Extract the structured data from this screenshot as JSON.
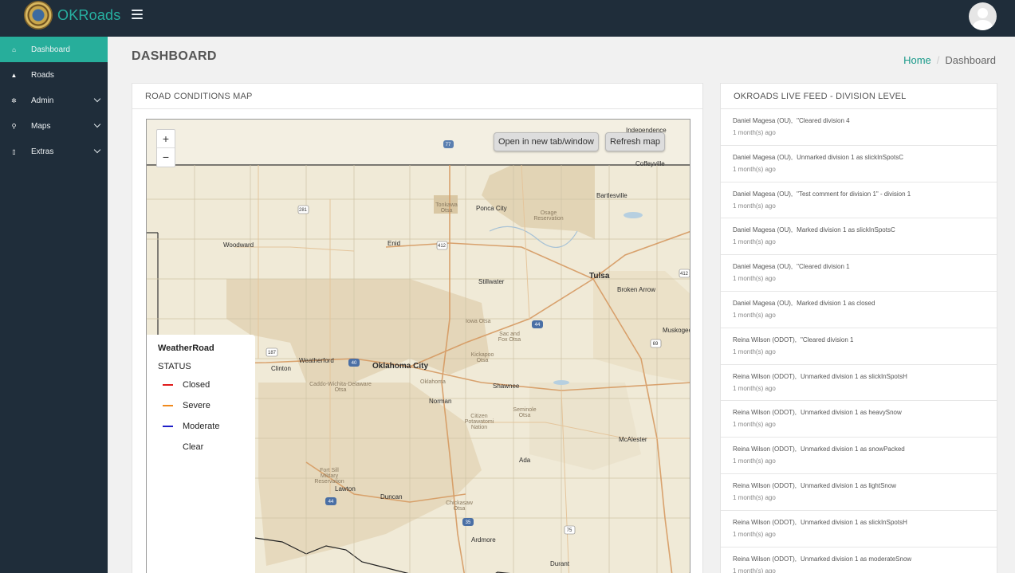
{
  "app": {
    "brand": "OKRoads"
  },
  "sidebar": {
    "items": [
      {
        "label": "Dashboard",
        "icon": "home-icon",
        "glyph": "⌂",
        "active": true,
        "has_children": false
      },
      {
        "label": "Roads",
        "icon": "road-icon",
        "glyph": "▲",
        "active": false,
        "has_children": false
      },
      {
        "label": "Admin",
        "icon": "gear-icon",
        "glyph": "✲",
        "active": false,
        "has_children": true
      },
      {
        "label": "Maps",
        "icon": "map-pin-icon",
        "glyph": "⚲",
        "active": false,
        "has_children": true
      },
      {
        "label": "Extras",
        "icon": "file-icon",
        "glyph": "▯",
        "active": false,
        "has_children": true
      }
    ]
  },
  "header": {
    "title": "DASHBOARD",
    "breadcrumb": {
      "home": "Home",
      "current": "Dashboard",
      "separator": "/"
    }
  },
  "map_panel": {
    "title": "ROAD CONDITIONS MAP",
    "zoom_in": "+",
    "zoom_out": "−",
    "open_button": "Open in new tab/window",
    "refresh_button": "Refresh map",
    "legend": {
      "title": "WeatherRoad",
      "subtitle": "STATUS",
      "items": [
        {
          "label": "Closed",
          "color": "#e01b1b"
        },
        {
          "label": "Severe",
          "color": "#f08a1d"
        },
        {
          "label": "Moderate",
          "color": "#1f1fc8"
        },
        {
          "label": "Clear",
          "color": "transparent"
        }
      ]
    },
    "cities": [
      "Independence",
      "Coffeyville",
      "Bartlesville",
      "Ponca City",
      "Osage Reservation",
      "Tonkawa Otsa",
      "Woodward",
      "Enid",
      "Stillwater",
      "Tulsa",
      "Broken Arrow",
      "Muskogee",
      "Iowa Otsa",
      "Sac and Fox Otsa",
      "Kickapoo Otsa",
      "Weatherford",
      "Clinton",
      "Oklahoma City",
      "Oklahoma",
      "Caddo-Wichita-Delaware Otsa",
      "Shawnee",
      "Norman",
      "Seminole Otsa",
      "Citizen Potawatomi Nation",
      "McAlester",
      "Ada",
      "Fort Sill Military Reservation",
      "Lawton",
      "Duncan",
      "Chickasaw Otsa",
      "Ardmore",
      "Durant"
    ],
    "highway_shields": [
      "77",
      "281",
      "412",
      "40",
      "44",
      "35",
      "69",
      "75",
      "412"
    ]
  },
  "feed": {
    "title": "OKROADS LIVE FEED - DIVISION LEVEL",
    "items": [
      {
        "user": "Daniel Magesa (OU),",
        "message": "\"Cleared division 4",
        "time": "1 month(s) ago"
      },
      {
        "user": "Daniel Magesa (OU),",
        "message": "Unmarked division 1 as slickInSpotsC",
        "time": "1 month(s) ago"
      },
      {
        "user": "Daniel Magesa (OU),",
        "message": "\"Test comment for division 1\" - division 1",
        "time": "1 month(s) ago"
      },
      {
        "user": "Daniel Magesa (OU),",
        "message": "Marked division 1 as slickInSpotsC",
        "time": "1 month(s) ago"
      },
      {
        "user": "Daniel Magesa (OU),",
        "message": "\"Cleared division 1",
        "time": "1 month(s) ago"
      },
      {
        "user": "Daniel Magesa (OU),",
        "message": "Marked division 1 as closed",
        "time": "1 month(s) ago"
      },
      {
        "user": "Reina Wilson (ODOT),",
        "message": "\"Cleared division 1",
        "time": "1 month(s) ago"
      },
      {
        "user": "Reina Wilson (ODOT),",
        "message": "Unmarked division 1 as slickInSpotsH",
        "time": "1 month(s) ago"
      },
      {
        "user": "Reina Wilson (ODOT),",
        "message": "Unmarked division 1 as heavySnow",
        "time": "1 month(s) ago"
      },
      {
        "user": "Reina Wilson (ODOT),",
        "message": "Unmarked division 1 as snowPacked",
        "time": "1 month(s) ago"
      },
      {
        "user": "Reina Wilson (ODOT),",
        "message": "Unmarked division 1 as lightSnow",
        "time": "1 month(s) ago"
      },
      {
        "user": "Reina Wilson (ODOT),",
        "message": "Unmarked division 1 as slickInSpotsH",
        "time": "1 month(s) ago"
      },
      {
        "user": "Reina Wilson (ODOT),",
        "message": "Unmarked division 1 as moderateSnow",
        "time": "1 month(s) ago"
      }
    ]
  },
  "colors": {
    "accent": "#27ae9b",
    "nav_bg": "#1f2d3a",
    "brand_text": "#27b0a1"
  }
}
